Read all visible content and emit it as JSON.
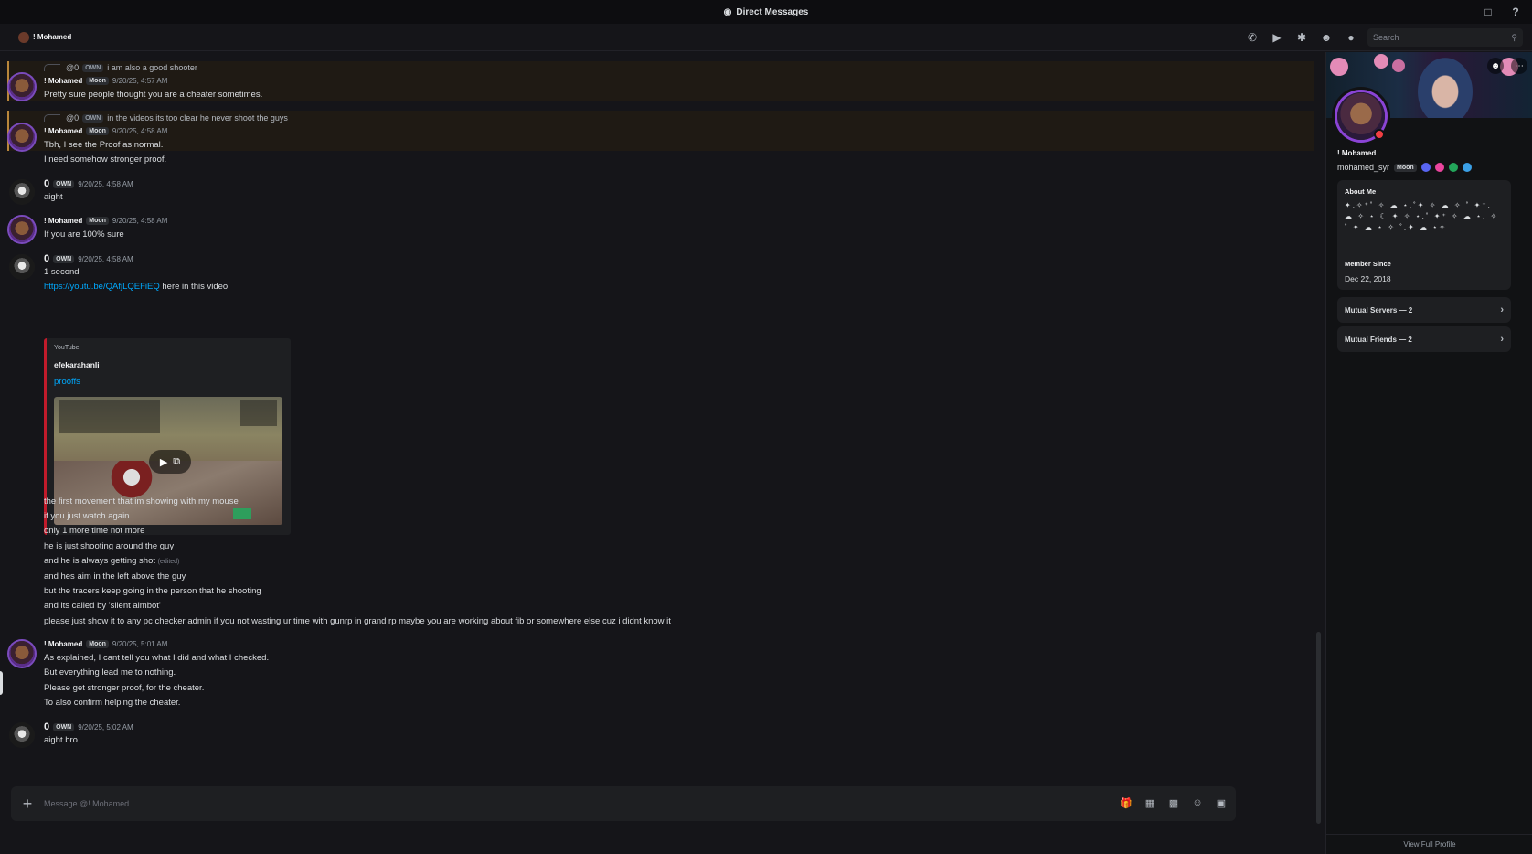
{
  "titlebar": {
    "title": "Direct Messages"
  },
  "header": {
    "name": "! Mohamed",
    "search_placeholder": "Search"
  },
  "messages": [
    {
      "reply_user": "@0",
      "reply_tag": "OWN",
      "reply_text": "i am also a good shooter",
      "author": "! Mohamed",
      "tag": "Moon",
      "time": "9/20/25, 4:57 AM",
      "lines": [
        "Pretty sure people thought you are a cheater sometimes."
      ]
    },
    {
      "reply_user": "@0",
      "reply_tag": "OWN",
      "reply_text": "in the videos its too clear he never shoot the guys",
      "author": "! Mohamed",
      "tag": "Moon",
      "time": "9/20/25, 4:58 AM",
      "lines": [
        "Tbh, I see the Proof as normal.",
        "I need somehow stronger proof."
      ]
    },
    {
      "author": "0",
      "tag": "OWN",
      "time": "9/20/25, 4:58 AM",
      "lines": [
        "aight"
      ]
    },
    {
      "author": "! Mohamed",
      "tag": "Moon",
      "time": "9/20/25, 4:58 AM",
      "lines": [
        "If you are 100% sure"
      ]
    },
    {
      "author": "0",
      "tag": "OWN",
      "time": "9/20/25, 4:58 AM",
      "lines": [
        "1 second"
      ],
      "link": "https://youtu.be/QAfjLQEFiEQ",
      "link_suffix": " here in this video",
      "embed": {
        "provider": "YouTube",
        "author": "efekarahanli",
        "title": "prooffs"
      },
      "after": [
        "the first movement that im showing with my mouse",
        "if you just watch again",
        "only 1 more time not more",
        "he is just shooting around the guy",
        "and he is always getting shot",
        "and hes aim in the left above the guy",
        "but the tracers keep going in the person that he shooting",
        "and its called by 'silent aimbot'",
        "please just show it to any pc checker admin if you not wasting ur time with gunrp in grand rp maybe you are working about fib or somewhere else cuz i didnt know it"
      ],
      "edited": "(edited)"
    },
    {
      "author": "! Mohamed",
      "tag": "Moon",
      "time": "9/20/25, 5:01 AM",
      "lines": [
        "As explained, I cant tell you what I did and what I checked.",
        "But everything lead me to nothing.",
        "Please get stronger proof, for the cheater.",
        "To also confirm helping the cheater."
      ]
    },
    {
      "author": "0",
      "tag": "OWN",
      "time": "9/20/25, 5:02 AM",
      "lines": [
        "aight bro"
      ]
    }
  ],
  "composer": {
    "placeholder": "Message @! Mohamed"
  },
  "profile": {
    "display_name": "! Mohamed",
    "username": "mohamed_syr",
    "tag": "Moon",
    "about_title": "About Me",
    "about_text": "✦.✧⁺˚ ✧ ☁ ⋆.˚✦ ✧ ☁ ✧.˚ ✦⁺. ☁ ✧ ⋆ ☾ ✦ ✧ ⋆.˚ ✦⁺ ✧ ☁ ⋆. ✧˚ ✦ ☁ ⋆ ✧ ˚.✦ ☁ ⋆✧",
    "member_since_label": "Member Since",
    "member_since": "Dec 22, 2018",
    "mutual_servers": "Mutual Servers — 2",
    "mutual_friends": "Mutual Friends — 2",
    "view_full": "View Full Profile"
  },
  "colors": {
    "accent_link": "#00a8fc",
    "highlight": "#b8863b",
    "status_dnd": "#f23f43",
    "embed_border": "#c11b2b"
  }
}
